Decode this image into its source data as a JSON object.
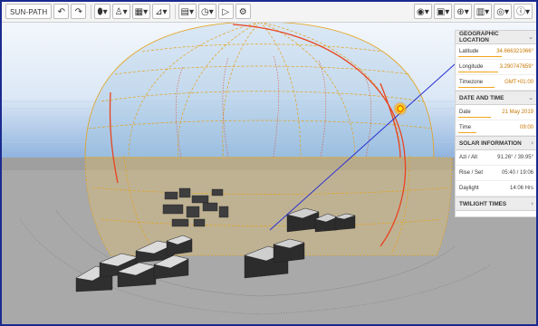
{
  "toolbar": {
    "sunpath_label": "SUN-PATH",
    "undo_icon": "undo-icon",
    "redo_icon": "redo-icon",
    "left_tools": [
      "cylinder-icon",
      "person-icon",
      "grid-icon",
      "chart-icon",
      "calendar-icon",
      "clock-icon",
      "play-icon",
      "settings-icon"
    ],
    "right_tools": [
      "eye-icon",
      "camera-icon",
      "globe-icon",
      "document-icon",
      "layers-icon",
      "info-icon"
    ],
    "dropdown_glyph": "▾"
  },
  "panel": {
    "geo": {
      "title": "GEOGRAPHIC LOCATION",
      "latitude_label": "Latitude",
      "latitude_value": "34.666321066°",
      "longitude_label": "Longitude",
      "longitude_value": "3.290747659°",
      "timezone_label": "Timezone",
      "timezone_value": "GMT+01:00"
    },
    "datetime": {
      "title": "DATE AND TIME",
      "date_label": "Date",
      "date_value": "21 May 2019",
      "time_label": "Time",
      "time_value": "09:00"
    },
    "solar": {
      "title": "SOLAR INFORMATION",
      "azi_label": "Azi / Alt",
      "azi_value": "91.26° / 39.95°",
      "rise_label": "Rise / Set",
      "rise_value": "05:40 / 19:06",
      "daylight_label": "Daylight",
      "daylight_value": "14:06 Hrs"
    },
    "twilight": {
      "title": "TWILIGHT TIMES"
    },
    "chevrons": {
      "down": "⌄",
      "right": "›"
    }
  },
  "colors": {
    "sky_top": "#dde9f7",
    "sky_bottom": "#8fb3de",
    "ground": "#a7a7a7",
    "dome_line": "#e4a21a",
    "sun_path": "#e8431e",
    "sun_ray": "#2a2fd0",
    "accent": "#f2a51a",
    "border": "#1b2a8f"
  }
}
